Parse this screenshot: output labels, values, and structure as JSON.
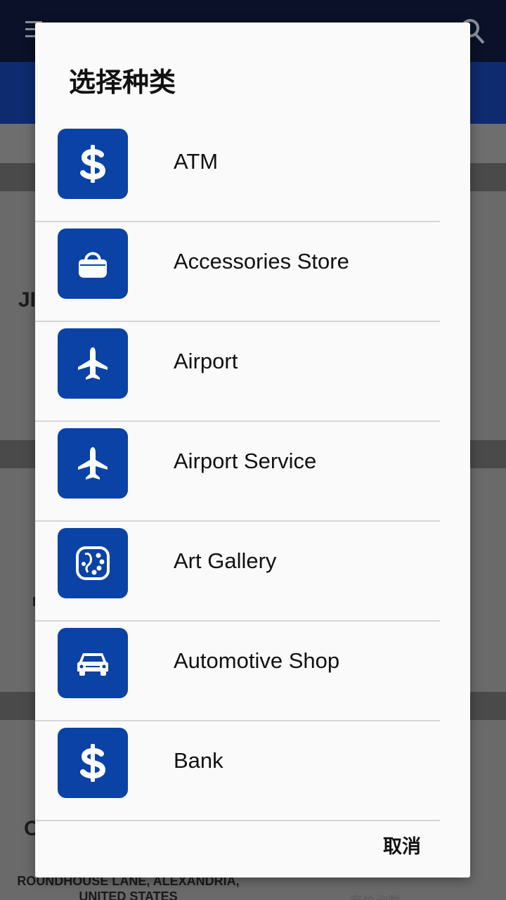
{
  "dialog": {
    "title": "选择种类",
    "cancel_label": "取消",
    "items": [
      {
        "label": "ATM",
        "icon": "dollar-icon"
      },
      {
        "label": "Accessories Store",
        "icon": "handbag-icon"
      },
      {
        "label": "Airport",
        "icon": "airplane-icon"
      },
      {
        "label": "Airport Service",
        "icon": "airplane-icon"
      },
      {
        "label": "Art Gallery",
        "icon": "palette-icon"
      },
      {
        "label": "Automotive Shop",
        "icon": "car-icon"
      },
      {
        "label": "Bank",
        "icon": "dollar-icon"
      }
    ]
  },
  "background": {
    "title_fragment": "...",
    "text_1": "JI",
    "text_2": "I",
    "text_3": "O",
    "address": "ROUNDHOUSE LANE, ALEXANDRIA, UNITED STATES",
    "right_text": "商位询数"
  },
  "colors": {
    "accent": "#0a42a6",
    "app_bar": "#0a1128"
  }
}
